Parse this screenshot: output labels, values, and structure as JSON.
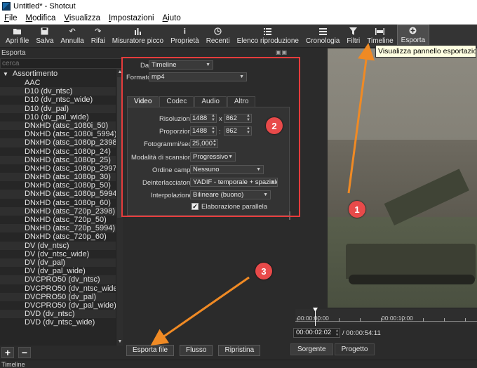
{
  "window": {
    "title": "Untitled* - Shotcut"
  },
  "menu": [
    {
      "label": "File",
      "u": "F"
    },
    {
      "label": "Modifica",
      "u": "M"
    },
    {
      "label": "Visualizza",
      "u": "V"
    },
    {
      "label": "Impostazioni",
      "u": "I"
    },
    {
      "label": "Aiuto",
      "u": "A"
    }
  ],
  "toolbar": {
    "open": "Apri file",
    "save": "Salva",
    "undo": "Annulla",
    "redo": "Rifai",
    "peak": "Misuratore picco",
    "props": "Proprietà",
    "recent": "Recenti",
    "playlist": "Elenco riproduzione",
    "history": "Cronologia",
    "filters": "Filtri",
    "timeline": "Timeline",
    "export": "Esporta"
  },
  "tooltip": "Visualizza pannello esportazione",
  "export_panel": {
    "title": "Esporta",
    "search_placeholder": "cerca",
    "group": "Assortimento",
    "presets": [
      "AAC",
      "D10 (dv_ntsc)",
      "D10 (dv_ntsc_wide)",
      "D10 (dv_pal)",
      "D10 (dv_pal_wide)",
      "DNxHD (atsc_1080i_50)",
      "DNxHD (atsc_1080i_5994)",
      "DNxHD (atsc_1080p_2398)",
      "DNxHD (atsc_1080p_24)",
      "DNxHD (atsc_1080p_25)",
      "DNxHD (atsc_1080p_2997)",
      "DNxHD (atsc_1080p_30)",
      "DNxHD (atsc_1080p_50)",
      "DNxHD (atsc_1080p_5994)",
      "DNxHD (atsc_1080p_60)",
      "DNxHD (atsc_720p_2398)",
      "DNxHD (atsc_720p_50)",
      "DNxHD (atsc_720p_5994)",
      "DNxHD (atsc_720p_60)",
      "DV (dv_ntsc)",
      "DV (dv_ntsc_wide)",
      "DV (dv_pal)",
      "DV (dv_pal_wide)",
      "DVCPRO50 (dv_ntsc)",
      "DVCPRO50 (dv_ntsc_wide)",
      "DVCPRO50 (dv_pal)",
      "DVCPRO50 (dv_pal_wide)",
      "DVD (dv_ntsc)",
      "DVD (dv_ntsc_wide)"
    ],
    "from_label": "Da",
    "from_value": "Timeline",
    "format_label": "Formato",
    "format_value": "mp4",
    "tabs": [
      "Video",
      "Codec",
      "Audio",
      "Altro"
    ],
    "video": {
      "resolution_label": "Risoluzione",
      "res_w": "1488",
      "res_h": "862",
      "aspect_label": "Proporzioni",
      "aspect_w": "1488",
      "aspect_h": "862",
      "fps_label": "Fotogrammi/sec",
      "fps": "25,000",
      "scan_label": "Modalità di scansione",
      "scan": "Progressivo",
      "field_label": "Ordine campi",
      "field": "Nessuno",
      "deint_label": "Deinterlacciatore",
      "deint": "YADIF - temporale + spaziale",
      "interp_label": "Interpolazione",
      "interp": "Bilineare (buono)",
      "parallel_label": "Elaborazione parallela",
      "parallel_checked": true,
      "x_sep": "x",
      "colon_sep": ":"
    },
    "buttons": {
      "export_file": "Esporta file",
      "stream": "Flusso",
      "reset": "Ripristina"
    }
  },
  "player": {
    "ruler_start": "00:00:00:00",
    "ruler_mid": "00:00:10:00",
    "timecode": "00:00:02:02",
    "duration": "/ 00:00:54:11",
    "tabs": [
      "Sorgente",
      "Progetto"
    ]
  },
  "status_bar": "Timeline",
  "annotations": {
    "badge1": "1",
    "badge2": "2",
    "badge3": "3",
    "arrow_color": "#f08a24",
    "badge_color": "#e84a4a"
  }
}
